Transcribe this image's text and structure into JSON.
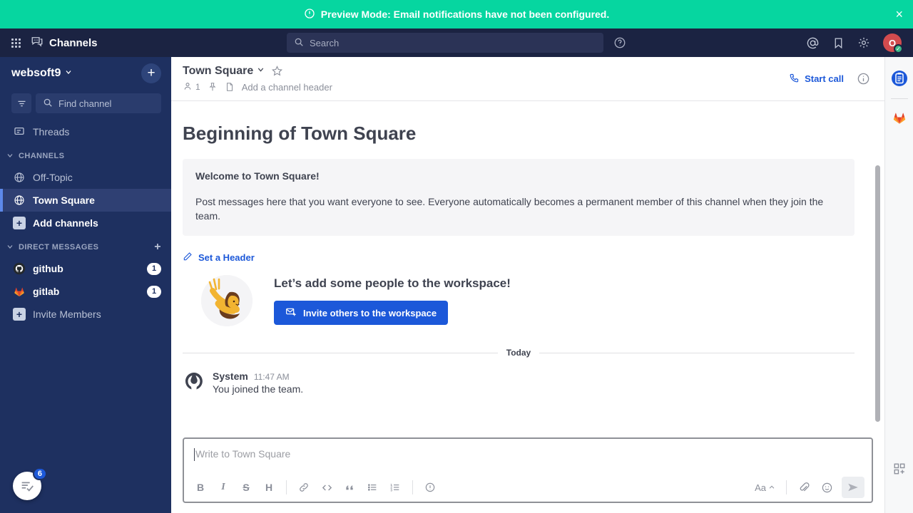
{
  "announcement": {
    "icon": "alert-circle-icon",
    "text": "Preview Mode: Email notifications have not been configured.",
    "close_label": "×",
    "color": "#06d6a0"
  },
  "global_header": {
    "product_name": "Channels",
    "grid_icon": "product-switcher-grid-icon",
    "product_icon": "channels-icon",
    "search": {
      "placeholder": "Search",
      "icon": "search-icon"
    },
    "help_icon": "help-circle-icon",
    "right_icons": [
      "at-mention-icon",
      "saved-posts-flag-icon",
      "settings-gear-icon"
    ],
    "avatar": {
      "initial": "O",
      "status": "online",
      "color": "#d24b4e",
      "status_color": "#3db887"
    }
  },
  "sidebar": {
    "team_name": "websoft9",
    "team_chevron": "chevron-down-icon",
    "add_button": "+",
    "filter_icon": "filter-icon",
    "find_channel": {
      "placeholder": "Find channel",
      "icon": "search-icon"
    },
    "threads": {
      "label": "Threads",
      "icon": "threads-icon"
    },
    "categories": [
      {
        "label": "CHANNELS",
        "chevron": "chevron-down-icon",
        "has_plus": false,
        "items": [
          {
            "label": "Off-Topic",
            "icon": "globe-icon",
            "active": false,
            "badge": ""
          },
          {
            "label": "Town Square",
            "icon": "globe-icon",
            "active": true,
            "badge": ""
          },
          {
            "label": "Add channels",
            "icon": "plus-square-icon",
            "active": false,
            "badge": "",
            "strong": true
          }
        ]
      },
      {
        "label": "DIRECT MESSAGES",
        "chevron": "chevron-down-icon",
        "has_plus": true,
        "plus_label": "+",
        "items": [
          {
            "label": "github",
            "icon": "github-avatar-icon",
            "active": false,
            "badge": "1",
            "strong": true
          },
          {
            "label": "gitlab",
            "icon": "gitlab-avatar-icon",
            "active": false,
            "badge": "1",
            "strong": true
          },
          {
            "label": "Invite Members",
            "icon": "plus-square-icon",
            "active": false,
            "badge": ""
          }
        ]
      }
    ],
    "fab": {
      "icon": "onboarding-checklist-icon",
      "badge": "6",
      "badge_color": "#1c58d9"
    }
  },
  "channel_header": {
    "title": "Town Square",
    "title_chevron": "chevron-down-icon",
    "favorite_icon": "star-outline-icon",
    "member_icon": "member-icon",
    "member_count": "1",
    "pin_icon": "pin-icon",
    "files_icon": "file-icon",
    "header_placeholder": "Add a channel header",
    "start_call": {
      "label": "Start call",
      "icon": "phone-icon"
    },
    "info_icon": "info-circle-icon"
  },
  "main": {
    "intro_title": "Beginning of Town Square",
    "welcome": {
      "title": "Welcome to Town Square!",
      "body": "Post messages here that you want everyone to see. Everyone automatically becomes a permanent member of this channel when they join the team."
    },
    "set_header": {
      "label": "Set a Header",
      "icon": "pencil-icon"
    },
    "invite": {
      "illustration": "waving-person-illustration",
      "title": "Let’s add some people to the workspace!",
      "button_label": "Invite others to the workspace",
      "button_icon": "invite-mail-icon",
      "button_color": "#1c58d9"
    },
    "date_separator": "Today",
    "posts": [
      {
        "avatar_icon": "mattermost-system-avatar-icon",
        "author": "System",
        "time": "11:47 AM",
        "text": "You joined the team."
      }
    ]
  },
  "composer": {
    "placeholder": "Write to Town Square",
    "toolbar_left": [
      {
        "name": "bold-icon",
        "glyph": "B"
      },
      {
        "name": "italic-icon",
        "glyph": "I"
      },
      {
        "name": "strikethrough-icon",
        "glyph": "S"
      },
      {
        "name": "heading-icon",
        "glyph": "H"
      },
      {
        "name": "link-icon",
        "glyph": "link"
      },
      {
        "name": "code-icon",
        "glyph": "<>"
      },
      {
        "name": "quote-icon",
        "glyph": "“"
      },
      {
        "name": "bulleted-list-icon",
        "glyph": "ul"
      },
      {
        "name": "ordered-list-icon",
        "glyph": "ol"
      },
      {
        "name": "info-icon",
        "glyph": "i"
      }
    ],
    "toolbar_right": {
      "formatting_label": "Aa",
      "formatting_chevron": "chevron-up-icon",
      "attach_icon": "paperclip-icon",
      "emoji_icon": "emoji-smile-icon",
      "send_icon": "send-icon"
    }
  },
  "app_bar": {
    "items": [
      {
        "name": "playbooks-icon",
        "color": "#1c58d9"
      },
      {
        "name": "gitlab-plugin-icon",
        "color": "#fc6d26"
      }
    ],
    "bottom": {
      "name": "app-marketplace-grid-icon"
    }
  }
}
